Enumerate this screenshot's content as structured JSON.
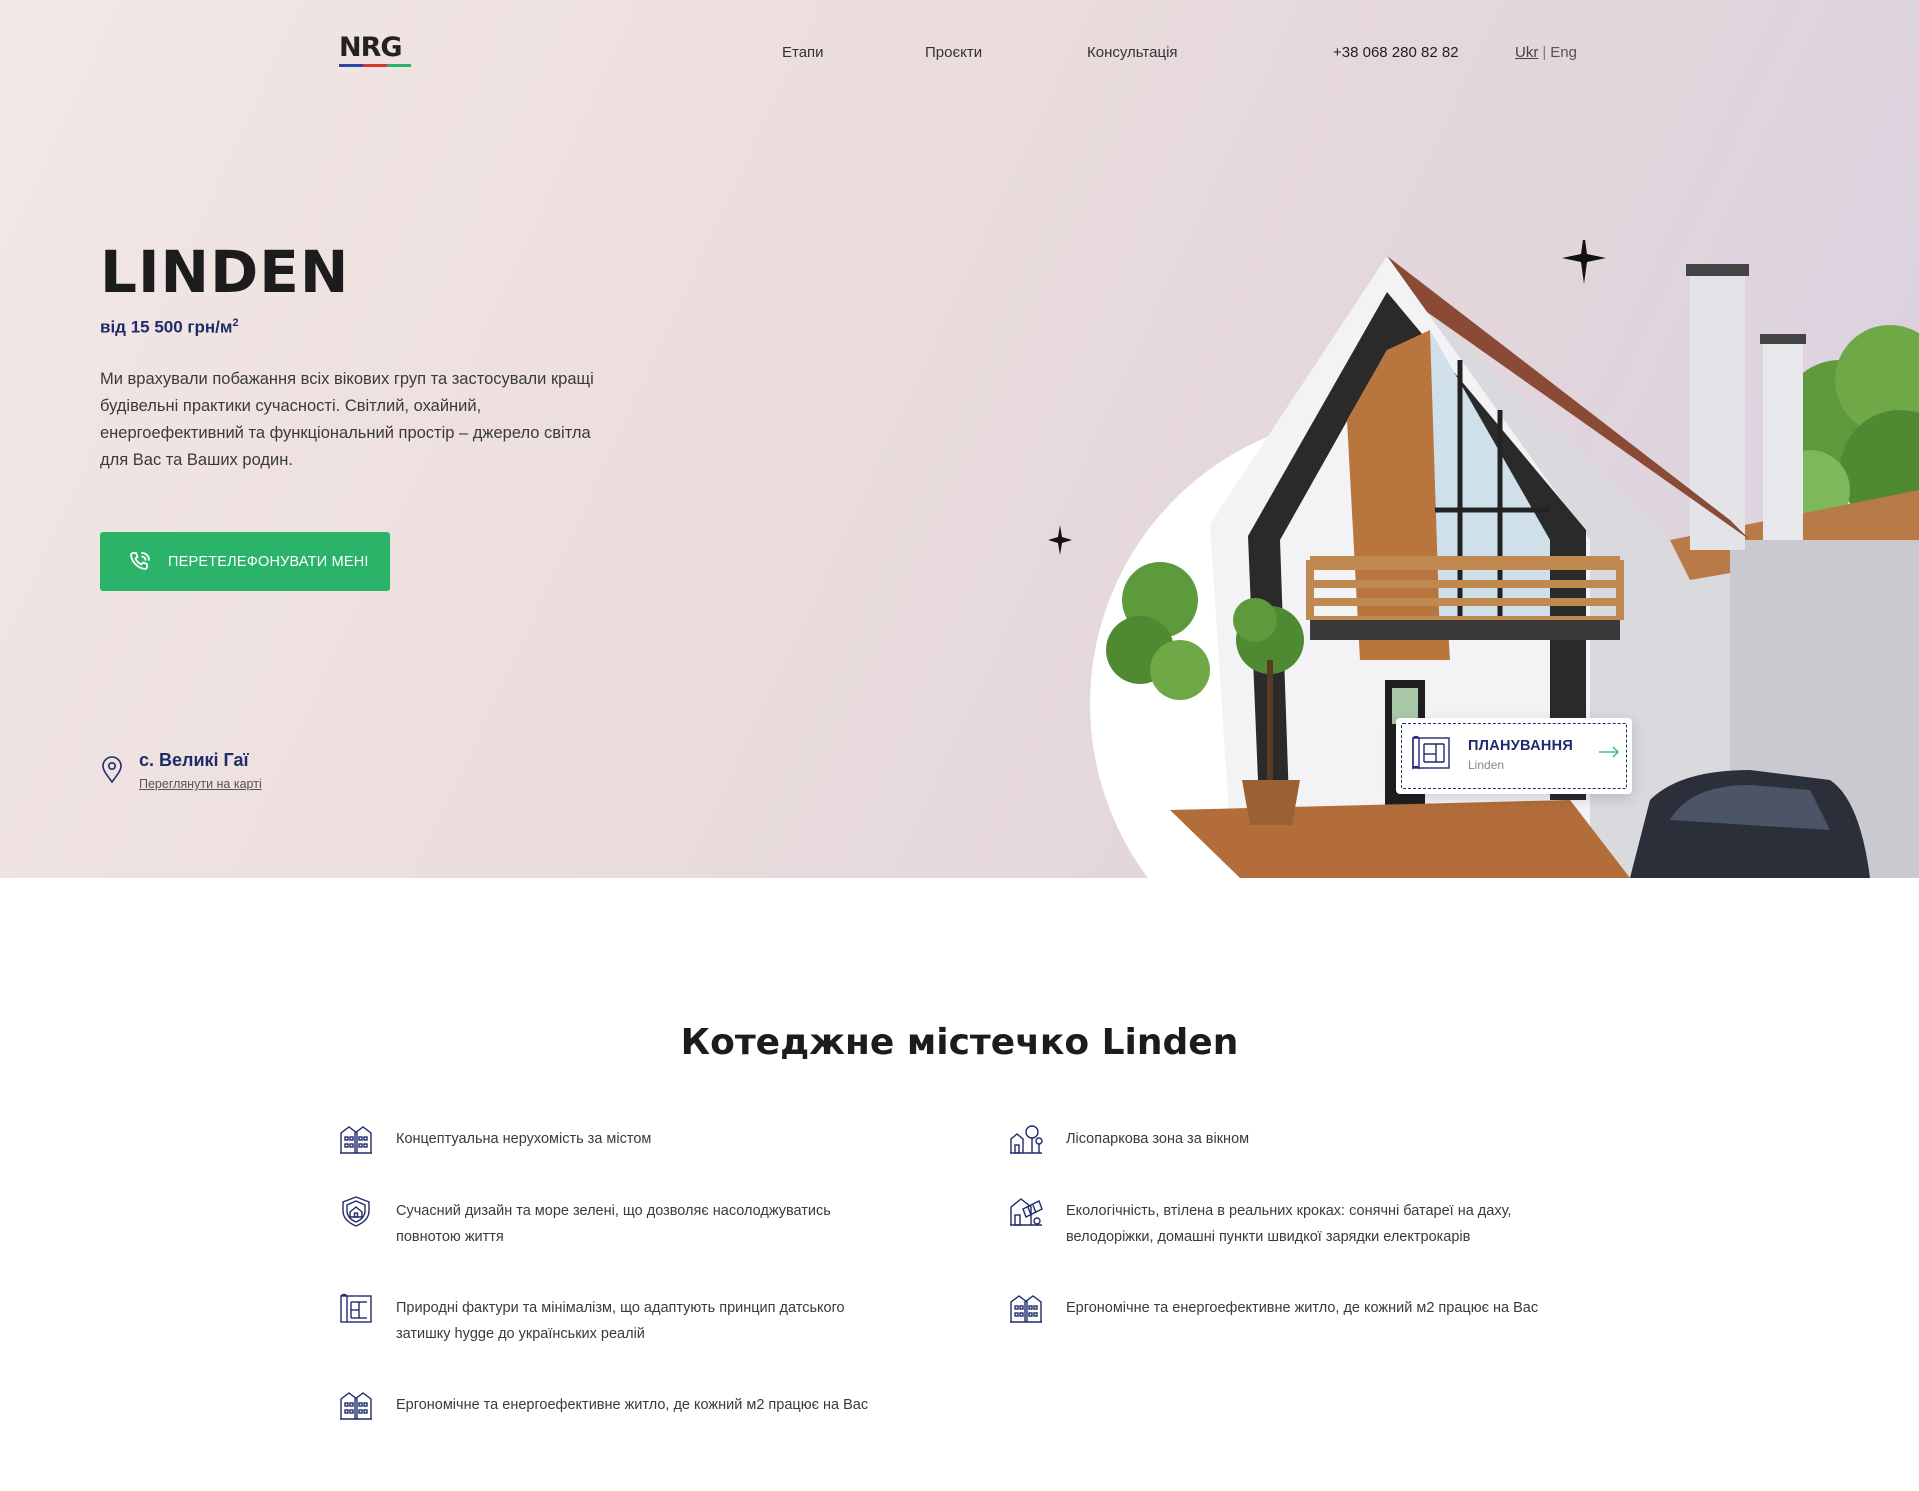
{
  "nav": {
    "logo_text": "NRG",
    "links": [
      "Етапи",
      "Проєкти",
      "Консультація"
    ],
    "phone": "+38 068 280 82 82",
    "lang_active": "Ukr",
    "lang_sep": "|",
    "lang_other": "Eng"
  },
  "hero": {
    "title": "LINDEN",
    "price": "від 15 500 грн/м",
    "price_sup": "2",
    "description": "Ми врахували побажання всіх вікових груп та застосували кращі будівельні практики сучасності. Світлий, охайний, енергоефективний та функціональний простір – джерело світла для Вас та Ваших родин.",
    "call_button": "ПЕРЕТЕЛЕФОНУВАТИ МЕНІ",
    "location_title": "с. Великі Гаї",
    "location_link": "Переглянути на карті",
    "plan_card_title": "ПЛАНУВАННЯ",
    "plan_card_subtitle": "Linden"
  },
  "section": {
    "title": "Котеджне містечко Linden",
    "features": [
      {
        "icon": "buildings-icon",
        "text": "Концептуальна нерухомість за містом"
      },
      {
        "icon": "park-icon",
        "text": "Лісопаркова зона за вікном"
      },
      {
        "icon": "shield-house-icon",
        "text": "Сучасний дизайн та море зелені, що дозволяє насолоджуватись повнотою життя"
      },
      {
        "icon": "solar-panel-icon",
        "text": "Екологічність, втілена в реальних кроках: сонячні батареї на даху, велодоріжки, домашні пункти швидкої зарядки електрокарів"
      },
      {
        "icon": "floorplan-icon",
        "text": "Природні фактури та мінімалізм, що адаптують принцип датського затишку hygge до українських реалій"
      },
      {
        "icon": "buildings-icon",
        "text": "Ергономічне та енергоефективне житло, де кожний м2 працює на Вас"
      },
      {
        "icon": "buildings-icon",
        "text": "Ергономічне та енергоефективне житло, де кожний м2 працює на Вас"
      }
    ]
  },
  "colors": {
    "accent_green": "#2bb36a",
    "brand_navy": "#1f2b6b",
    "logo_blue": "#2a48a8",
    "logo_red": "#d63a2f",
    "logo_green": "#2bb36a"
  }
}
